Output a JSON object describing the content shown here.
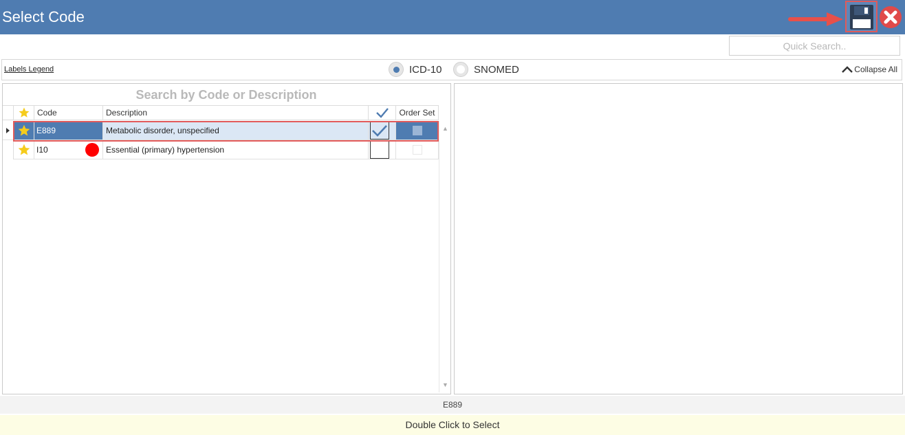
{
  "window": {
    "title": "Select Code"
  },
  "toolbar": {
    "quick_search_placeholder": "Quick Search..",
    "labels_legend": "Labels Legend",
    "radio_icd10": "ICD-10",
    "radio_snomed": "SNOMED",
    "selected_system": "ICD-10",
    "collapse_all": "Collapse All"
  },
  "grid": {
    "title": "Search by Code or Description",
    "columns": {
      "code": "Code",
      "description": "Description",
      "order_set": "Order Set"
    },
    "rows": [
      {
        "code": "E889",
        "description": "Metabolic disorder, unspecified",
        "checked": true,
        "favorite": true
      },
      {
        "code": "I10",
        "description": "Essential (primary) hypertension",
        "checked": false,
        "favorite": true
      }
    ]
  },
  "status": {
    "selected_code": "E889"
  },
  "footer": {
    "hint": "Double Click to Select"
  },
  "colors": {
    "titlebar": "#4f7cb1",
    "highlight_border": "#e25a5a",
    "close_red": "#e04a4a",
    "star": "#f5cc1c"
  }
}
